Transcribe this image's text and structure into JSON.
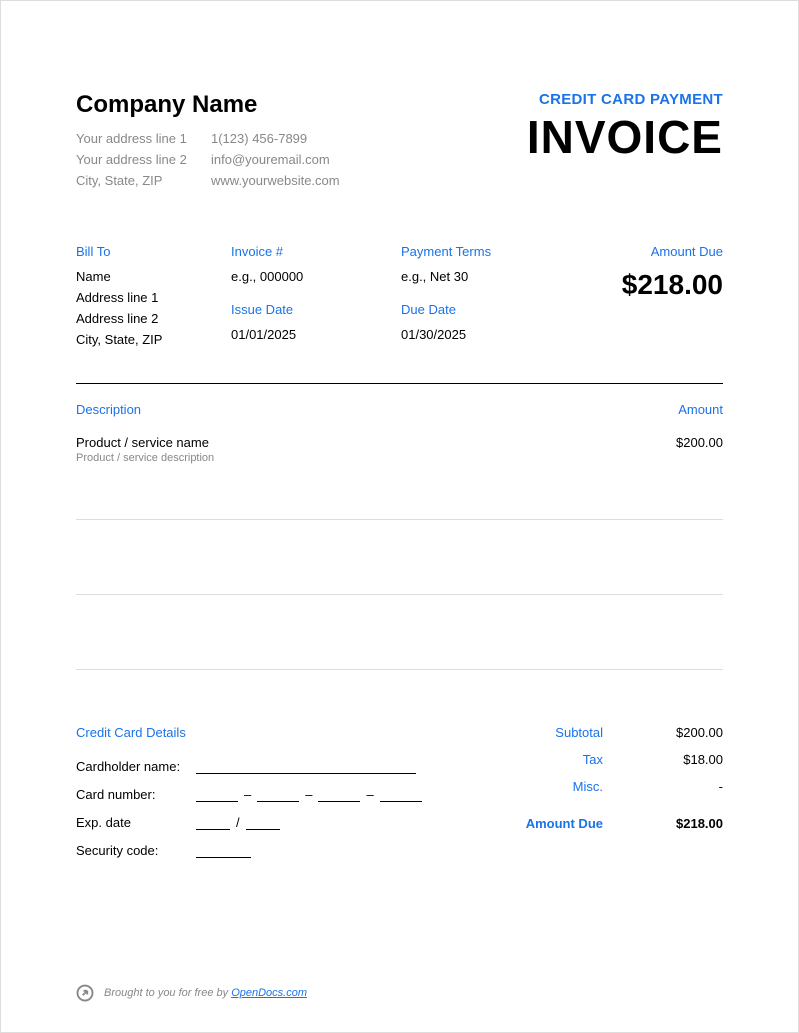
{
  "header": {
    "company_name": "Company Name",
    "address1": "Your address line 1",
    "address2": "Your address line 2",
    "city_state_zip": "City, State, ZIP",
    "phone": "1(123) 456-7899",
    "email": "info@youremail.com",
    "website": "www.yourwebsite.com",
    "title_sub": "CREDIT CARD PAYMENT",
    "title_main": "INVOICE"
  },
  "meta": {
    "bill_to_label": "Bill To",
    "bill_to_name": "Name",
    "bill_to_addr1": "Address line 1",
    "bill_to_addr2": "Address line 2",
    "bill_to_csz": "City, State, ZIP",
    "invoice_num_label": "Invoice #",
    "invoice_num": "e.g., 000000",
    "issue_date_label": "Issue Date",
    "issue_date": "01/01/2025",
    "terms_label": "Payment Terms",
    "terms": "e.g., Net 30",
    "due_date_label": "Due Date",
    "due_date": "01/30/2025",
    "amount_due_label": "Amount Due",
    "amount_due": "$218.00"
  },
  "items": {
    "desc_header": "Description",
    "amt_header": "Amount",
    "rows": [
      {
        "name": "Product / service name",
        "desc": "Product / service description",
        "amount": "$200.00"
      }
    ]
  },
  "cc": {
    "title": "Credit Card Details",
    "cardholder_label": "Cardholder name:",
    "cardnum_label": "Card number:",
    "exp_label": "Exp. date",
    "sec_label": "Security code:",
    "dash": "–",
    "slash": "/"
  },
  "totals": {
    "subtotal_label": "Subtotal",
    "subtotal": "$200.00",
    "tax_label": "Tax",
    "tax": "$18.00",
    "misc_label": "Misc.",
    "misc": "-",
    "amount_due_label": "Amount Due",
    "amount_due": "$218.00"
  },
  "footer": {
    "text_prefix": "Brought to you for free by ",
    "link_text": "OpenDocs.com"
  }
}
